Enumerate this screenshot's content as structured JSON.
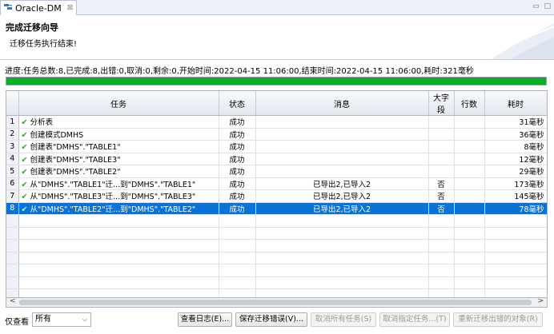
{
  "tab": {
    "title": "Oracle-DM",
    "close": "⊠"
  },
  "window_controls": {
    "minimize": "▭",
    "maximize": "□"
  },
  "wizard": {
    "title": "完成迁移向导",
    "description": "迁移任务执行结束!"
  },
  "progress": {
    "text": "进度:任务总数:8,已完成:8,出错:0,取消:0,剩余:0,开始时间:2022-04-15 11:06:00,结束时间:2022-04-15 11:06:00,耗时:321毫秒",
    "fraction": 1.0,
    "color": "#06b025"
  },
  "table": {
    "columns": [
      "",
      "任务",
      "状态",
      "消息",
      "大字段",
      "行数",
      "耗时"
    ],
    "rows": [
      {
        "num": "1",
        "task": "分析表",
        "status": "成功",
        "message": "",
        "lob": "",
        "rows": "",
        "time": "31毫秒"
      },
      {
        "num": "2",
        "task": "创建模式DMHS",
        "status": "成功",
        "message": "",
        "lob": "",
        "rows": "",
        "time": "36毫秒"
      },
      {
        "num": "3",
        "task": "创建表\"DMHS\".\"TABLE1\"",
        "status": "成功",
        "message": "",
        "lob": "",
        "rows": "",
        "time": "8毫秒"
      },
      {
        "num": "4",
        "task": "创建表\"DMHS\".\"TABLE3\"",
        "status": "成功",
        "message": "",
        "lob": "",
        "rows": "",
        "time": "12毫秒"
      },
      {
        "num": "5",
        "task": "创建表\"DMHS\".\"TABLE2\"",
        "status": "成功",
        "message": "",
        "lob": "",
        "rows": "",
        "time": "29毫秒"
      },
      {
        "num": "6",
        "task": "从\"DMHS\".\"TABLE1\"迁...到\"DMHS\".\"TABLE1\"",
        "status": "成功",
        "message": "已导出2,已导入2",
        "lob": "否",
        "rows": "",
        "time": "173毫秒"
      },
      {
        "num": "7",
        "task": "从\"DMHS\".\"TABLE3\"迁...到\"DMHS\".\"TABLE3\"",
        "status": "成功",
        "message": "已导出2,已导入2",
        "lob": "否",
        "rows": "",
        "time": "145毫秒"
      },
      {
        "num": "8",
        "task": "从\"DMHS\".\"TABLE2\"迁...到\"DMHS\".\"TABLE2\"",
        "status": "成功",
        "message": "已导出2,已导入2",
        "lob": "否",
        "rows": "",
        "time": "78毫秒"
      }
    ],
    "selected_row": "8",
    "check_glyph": "✔"
  },
  "scrollbar": {
    "left": "<",
    "right": ">"
  },
  "footer": {
    "only_view_label": "仅查看",
    "filter_value": "所有",
    "filter_chevron": "⌵",
    "buttons": {
      "view_log": "查看日志(E)...",
      "save_errors": "保存迁移错误(V)...",
      "cancel_all": "取消所有任务(S)",
      "cancel_selected": "取消指定任务...(T)",
      "remigrate": "重新迁移出错的对象(R)"
    }
  }
}
